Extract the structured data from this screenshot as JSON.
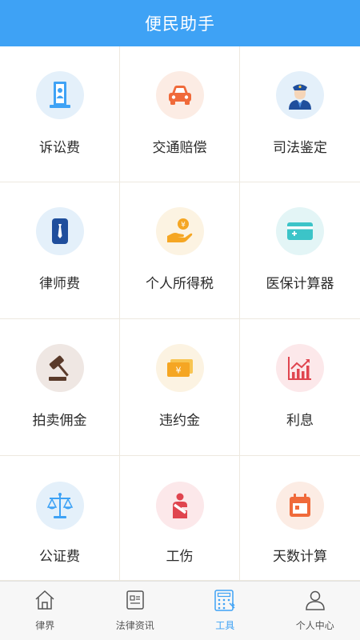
{
  "header": {
    "title": "便民助手"
  },
  "colors": {
    "brand": "#3ea2f5",
    "icon_bg_blue": "#e4f0fa",
    "icon_bg_orange": "#fcece4",
    "icon_bg_yellow": "#fcf3e2",
    "icon_bg_red": "#fce8ea",
    "icon_bg_brown": "#efe7e3",
    "icon_bg_teal": "#e3f5f6"
  },
  "tools": [
    {
      "label": "诉讼费",
      "icon": "certificate-icon"
    },
    {
      "label": "交通赔偿",
      "icon": "car-icon"
    },
    {
      "label": "司法鉴定",
      "icon": "police-officer-icon"
    },
    {
      "label": "律师费",
      "icon": "necktie-icon"
    },
    {
      "label": "个人所得税",
      "icon": "yuan-hand-icon"
    },
    {
      "label": "医保计算器",
      "icon": "medical-card-icon"
    },
    {
      "label": "拍卖佣金",
      "icon": "gavel-icon"
    },
    {
      "label": "违约金",
      "icon": "banknote-icon"
    },
    {
      "label": "利息",
      "icon": "growth-chart-icon"
    },
    {
      "label": "公证费",
      "icon": "scales-icon"
    },
    {
      "label": "工伤",
      "icon": "injured-worker-icon"
    },
    {
      "label": "天数计算",
      "icon": "calendar-icon"
    }
  ],
  "tabbar": {
    "items": [
      {
        "label": "律界",
        "icon": "home-icon",
        "active": false
      },
      {
        "label": "法律资讯",
        "icon": "news-icon",
        "active": false
      },
      {
        "label": "工具",
        "icon": "calculator-icon",
        "active": true
      },
      {
        "label": "个人中心",
        "icon": "person-icon",
        "active": false
      }
    ]
  }
}
